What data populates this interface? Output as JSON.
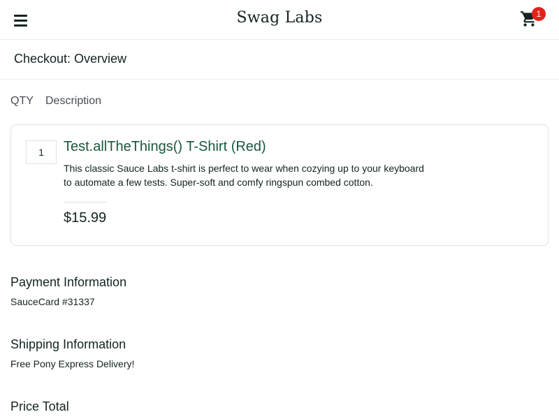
{
  "header": {
    "logo": "Swag Labs",
    "cart_badge": "1"
  },
  "page": {
    "title": "Checkout: Overview"
  },
  "cart": {
    "qty_label": "QTY",
    "desc_label": "Description",
    "items": [
      {
        "quantity": "1",
        "name": "Test.allTheThings() T-Shirt (Red)",
        "description": "This classic Sauce Labs t-shirt is perfect to wear when cozying up to your keyboard to automate a few tests. Super-soft and comfy ringspun combed cotton.",
        "price": "$15.99"
      }
    ]
  },
  "summary": {
    "payment_label": "Payment Information",
    "payment_value": "SauceCard #31337",
    "shipping_label": "Shipping Information",
    "shipping_value": "Free Pony Express Delivery!",
    "price_total_label": "Price Total"
  },
  "colors": {
    "accent_green": "#18583a",
    "badge_red": "#e2231a",
    "text_dark": "#132322"
  }
}
